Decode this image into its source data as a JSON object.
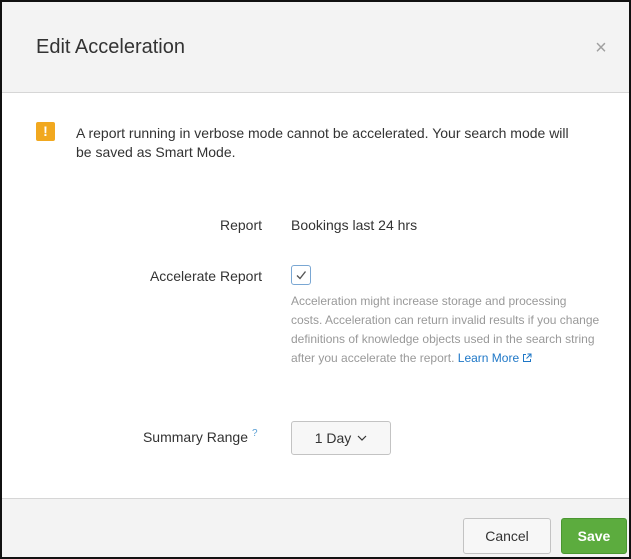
{
  "dialog": {
    "title": "Edit Acceleration",
    "close_icon": "close-icon",
    "close_glyph": "×"
  },
  "warning": {
    "icon": "warning-icon",
    "icon_glyph": "!",
    "icon_color": "#f1a81f",
    "message": "A report running in verbose mode cannot be accelerated. Your search mode will be saved as Smart Mode."
  },
  "report": {
    "label": "Report",
    "value": "Bookings last 24 hrs"
  },
  "accelerate": {
    "label": "Accelerate Report",
    "checked": true,
    "help_text": "Acceleration might increase storage and processing costs. Acceleration can return invalid results if you change definitions of knowledge objects used in the search string after you accelerate the report. ",
    "learn_more": "Learn More",
    "learn_more_icon": "external-link-icon"
  },
  "summary_range": {
    "label": "Summary Range",
    "help_marker": "?",
    "selected": "1 Day",
    "dropdown_icon": "chevron-down-icon"
  },
  "footer": {
    "cancel_label": "Cancel",
    "save_label": "Save",
    "save_color": "#5cac3e"
  }
}
